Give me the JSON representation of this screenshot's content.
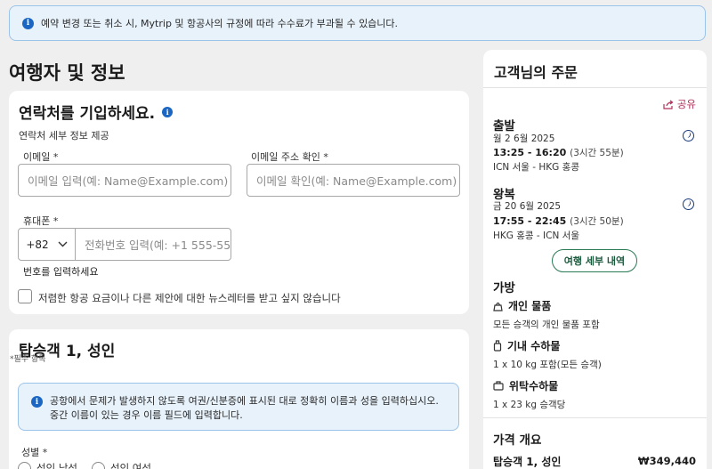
{
  "notice": {
    "text": "예약 변경 또는 취소 시, Mytrip 및 항공사의 규정에 따라 수수료가 부과될 수 있습니다."
  },
  "page_title": "여행자 및 정보",
  "contact": {
    "title": "연락처를 기입하세요.",
    "subtitle": "연락처 세부 정보 제공",
    "email_label": "이메일 *",
    "email_placeholder": "이메일 입력(예: Name@Example.com)",
    "email_confirm_label": "이메일 주소 확인 *",
    "email_confirm_placeholder": "이메일 확인(예: Name@Example.com)",
    "phone_label": "휴대폰 *",
    "country_code": "+82",
    "phone_placeholder": "전화번호 입력(예: +1 555-55",
    "phone_error": "번호를 입력하세요",
    "newsletter_label": "저렴한 항공 요금이나 다른 제안에 대한 뉴스레터를 받고 싶지 않습니다"
  },
  "passenger": {
    "title": "탑승객 1, 성인",
    "required_note": "*필수 항목",
    "info_text": "공항에서 문제가 발생하지 않도록 여권/신분증에 표시된 대로 정확히 이름과 성을 입력하십시오. 중간 이름이 있는 경우 이름 필드에 입력합니다.",
    "gender_label": "성별 *",
    "gender_options": [
      "성인 남성",
      "성인 여성"
    ]
  },
  "order": {
    "title": "고객님의 주문",
    "share_label": "공유",
    "outbound": {
      "heading": "출발",
      "date": "월 2 6월 2025",
      "time": "13:25 - 16:20",
      "duration": "(3시간 55분)",
      "route": "ICN 서울 - HKG 홍콩"
    },
    "inbound": {
      "heading": "왕복",
      "date": "금 20 6월 2025",
      "time": "17:55 - 22:45",
      "duration": "(3시간 50분)",
      "route": "HKG 홍콩 - ICN 서울"
    },
    "details_button": "여행 세부 내역",
    "baggage": {
      "heading": "가방",
      "personal_label": "개인 물품",
      "personal_desc": "모든 승객의 개인 물품 포함",
      "carryon_label": "기내 수하물",
      "carryon_desc": "1 x 10 kg 포함(모든 승객)",
      "checked_label": "위탁수하물",
      "checked_desc": "1 x 23 kg 승객당"
    },
    "price_summary": {
      "heading": "가격 개요",
      "passenger_label": "탑승객 1, 성인",
      "passenger_price": "₩349,440"
    }
  },
  "colors": {
    "accent_green": "#2a7a55",
    "info_blue": "#1a66c2",
    "share_pink": "#b0315a"
  }
}
